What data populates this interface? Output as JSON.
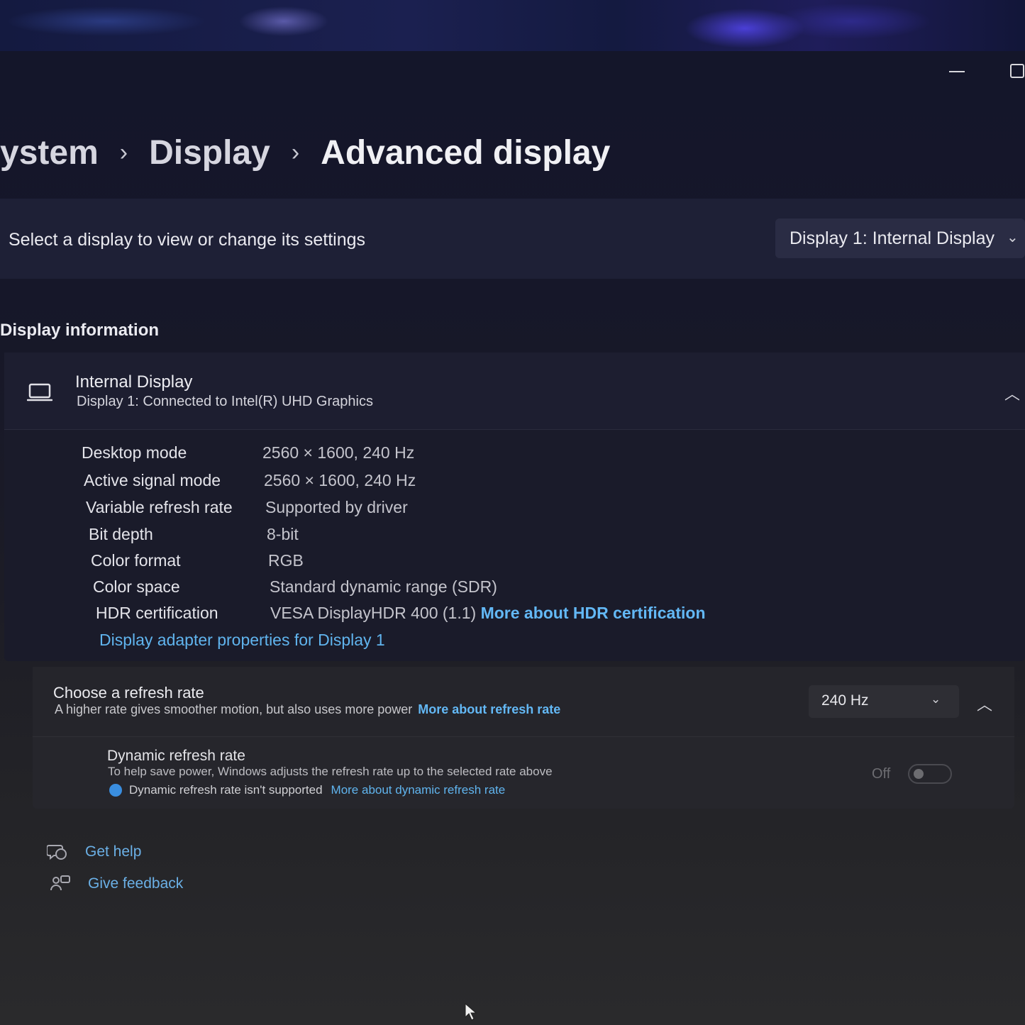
{
  "breadcrumb": {
    "items": [
      "ystem",
      "Display",
      "Advanced display"
    ],
    "separator": "›"
  },
  "display_select": {
    "label": "Select a display to view or change its settings",
    "selected": "Display 1: Internal Display"
  },
  "display_information": {
    "title": "Display information",
    "device_name": "Internal Display",
    "device_subtitle": "Display 1: Connected to Intel(R) UHD Graphics",
    "properties": [
      {
        "label": "Desktop mode",
        "value": "2560 × 1600, 240 Hz"
      },
      {
        "label": "Active signal mode",
        "value": "2560 × 1600, 240 Hz"
      },
      {
        "label": "Variable refresh rate",
        "value": "Supported by driver"
      },
      {
        "label": "Bit depth",
        "value": "8-bit"
      },
      {
        "label": "Color format",
        "value": "RGB"
      },
      {
        "label": "Color space",
        "value": "Standard dynamic range (SDR)"
      },
      {
        "label": "HDR certification",
        "value": "VESA DisplayHDR 400 (1.1)"
      }
    ],
    "hdr_link": "More about HDR certification",
    "adapter_link": "Display adapter properties for Display 1"
  },
  "refresh_rate": {
    "title": "Choose a refresh rate",
    "subtitle": "A higher rate gives smoother motion, but also uses more power",
    "link": "More about refresh rate",
    "selected": "240 Hz"
  },
  "dynamic_refresh": {
    "title": "Dynamic refresh rate",
    "subtitle": "To help save power, Windows adjusts the refresh rate up to the selected rate above",
    "warning": "Dynamic refresh rate isn't supported",
    "link": "More about dynamic refresh rate",
    "toggle_state": "Off"
  },
  "help": {
    "get_help": "Get help",
    "give_feedback": "Give feedback"
  },
  "colors": {
    "accent_link": "#63b8f5",
    "window_bg_top": "#14162a",
    "window_bg_bottom": "#2a2a2c"
  }
}
